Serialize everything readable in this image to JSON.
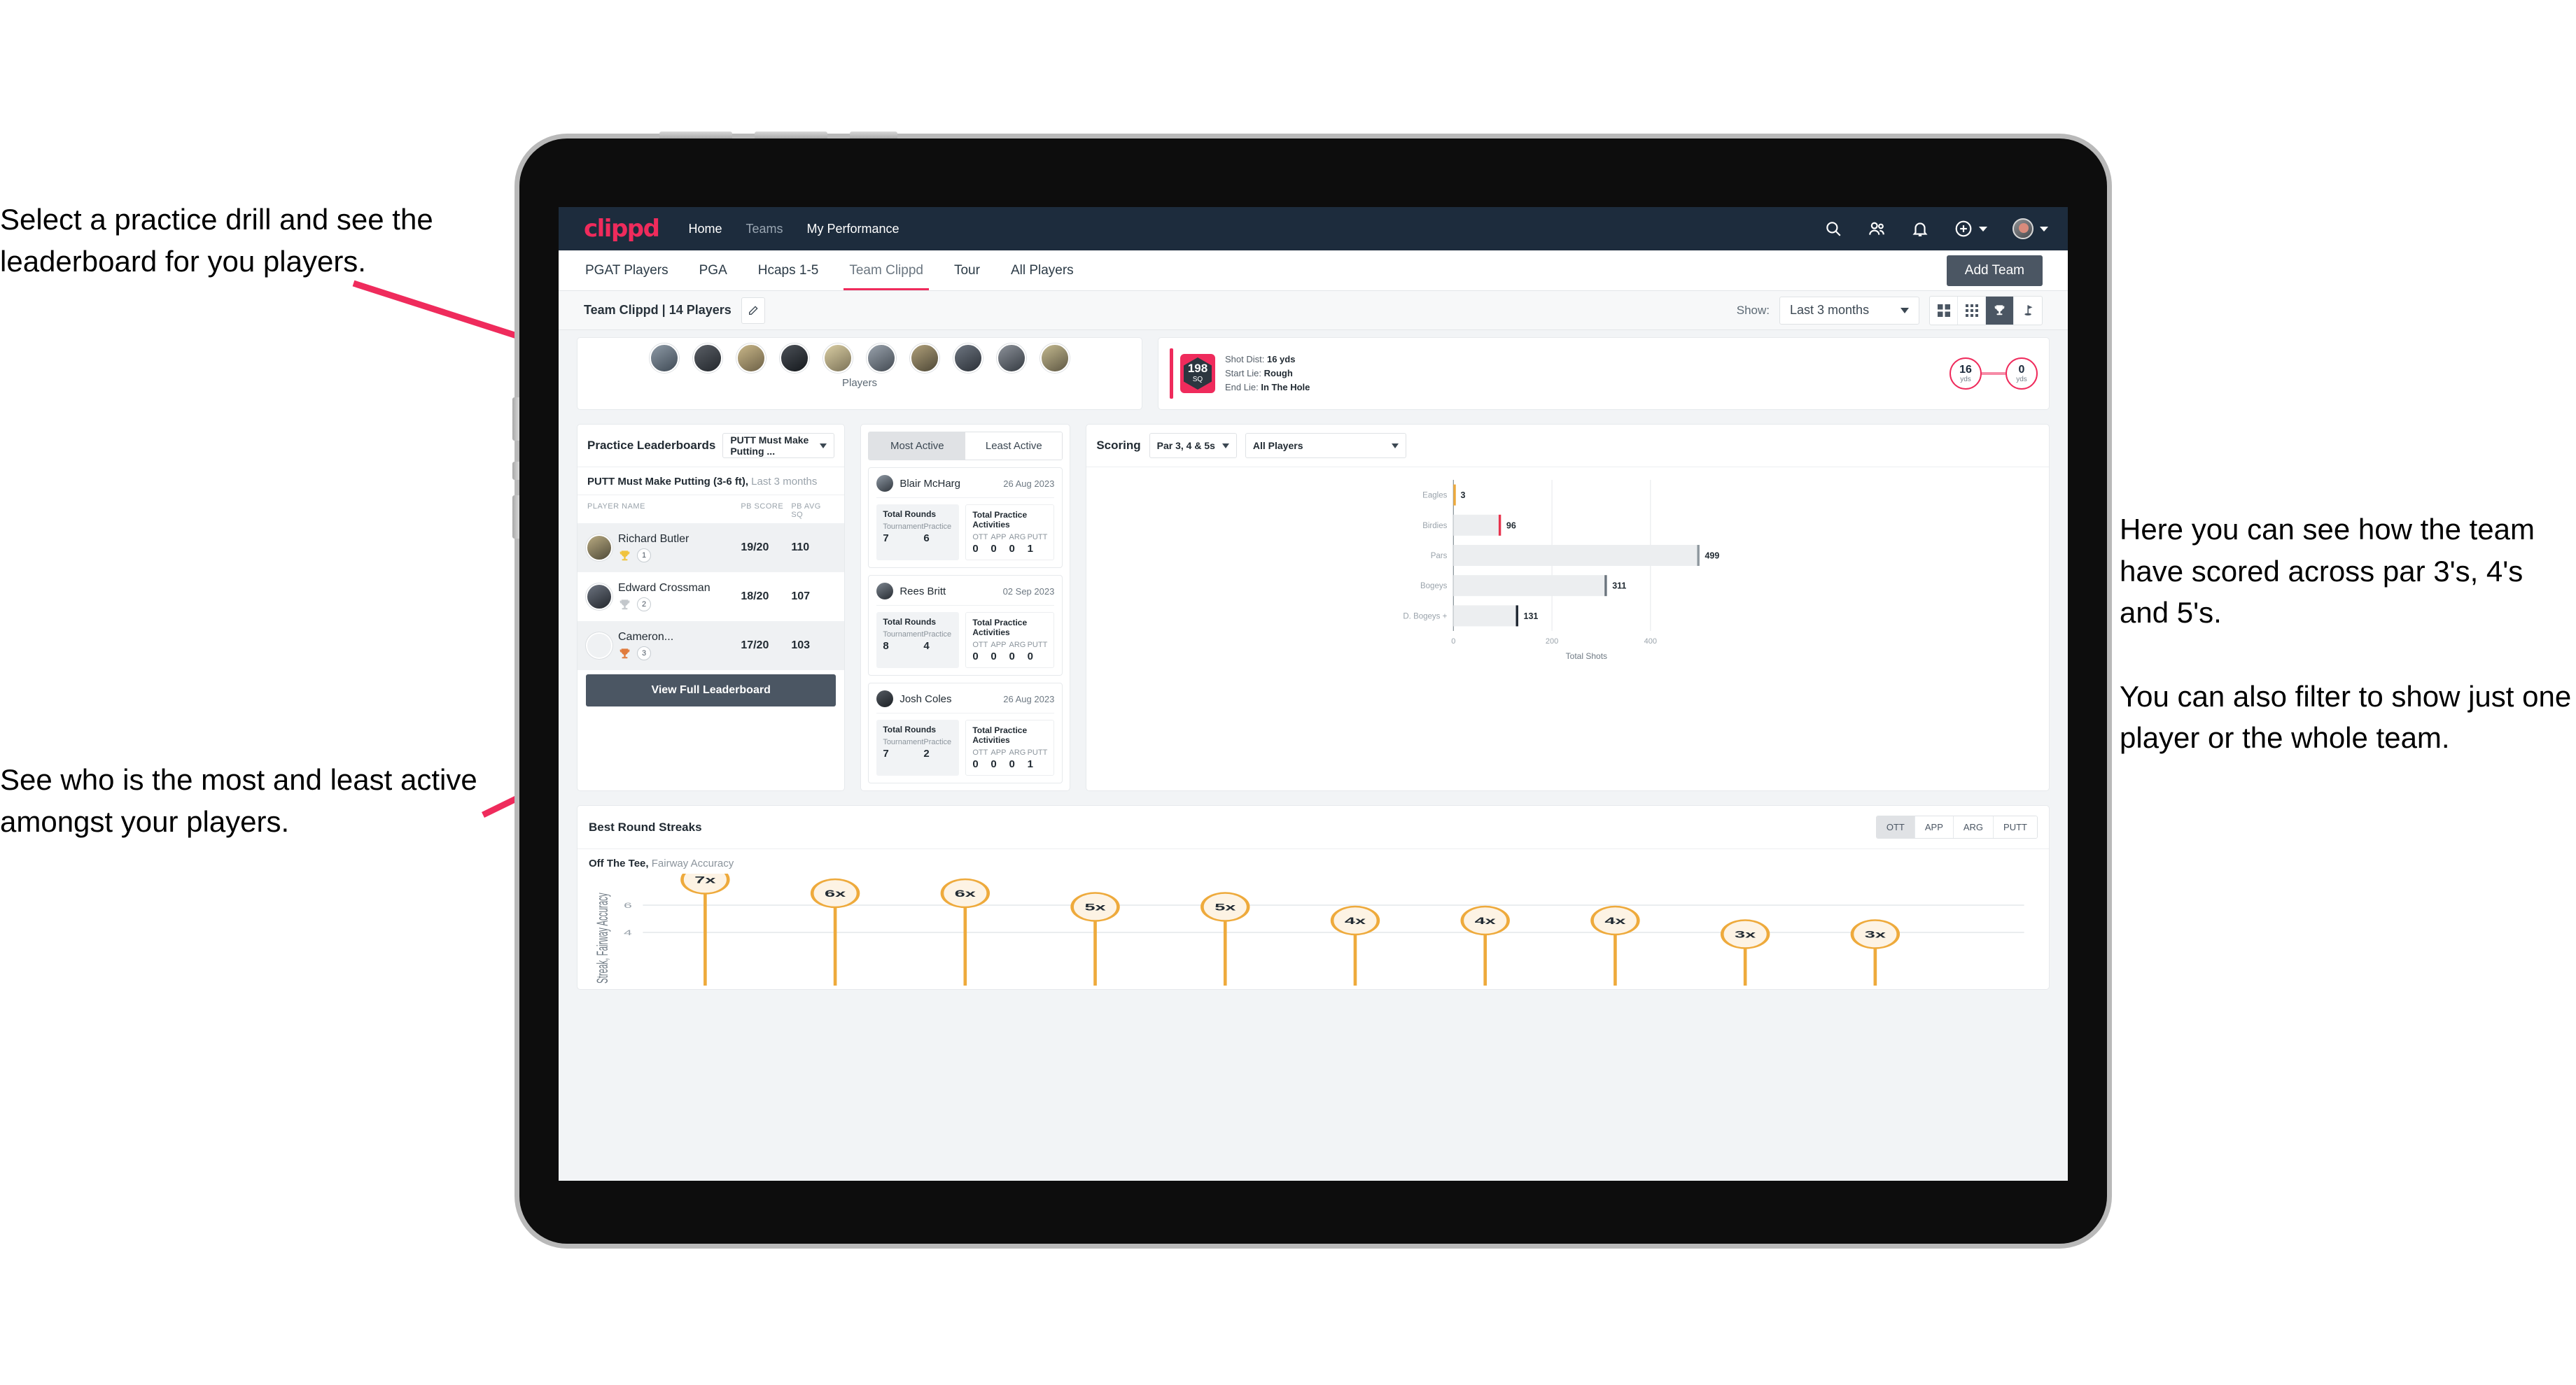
{
  "annotations": {
    "practice": "Select a practice drill and see the leaderboard for you players.",
    "active": "See who is the most and least active amongst your players.",
    "scoring": "Here you can see how the team have scored across par 3's, 4's and 5's.\n\nYou can also filter to show just one player or the whole team."
  },
  "appbar": {
    "logo": "clippd",
    "nav": [
      {
        "label": "Home",
        "dim": false
      },
      {
        "label": "Teams",
        "dim": true
      },
      {
        "label": "My Performance",
        "dim": false
      }
    ],
    "icons": [
      "search-icon",
      "people-icon",
      "bell-icon",
      "plus-circle-icon",
      "avatar"
    ]
  },
  "tabs": [
    {
      "label": "PGAT Players",
      "active": false
    },
    {
      "label": "PGA",
      "active": false
    },
    {
      "label": "Hcaps 1-5",
      "active": false
    },
    {
      "label": "Team Clippd",
      "active": true
    },
    {
      "label": "Tour",
      "active": false
    },
    {
      "label": "All Players",
      "active": false
    }
  ],
  "add_team_label": "Add Team",
  "toolbar": {
    "team_label": "Team Clippd | 14 Players",
    "edit_icon": "pencil-icon",
    "show_label": "Show:",
    "range_value": "Last 3 months",
    "view_modes": [
      {
        "name": "grid-2x2-icon",
        "active": false
      },
      {
        "name": "grid-3x3-icon",
        "active": false
      },
      {
        "name": "trophy-icon",
        "active": true
      },
      {
        "name": "flag-icon",
        "active": false
      }
    ]
  },
  "players_card": {
    "caption": "Players",
    "count": 10
  },
  "shot_card": {
    "sq_value": "198",
    "sq_unit": "SQ",
    "lines": [
      {
        "key": "Shot Dist:",
        "val": "16 yds"
      },
      {
        "key": "Start Lie:",
        "val": "Rough"
      },
      {
        "key": "End Lie:",
        "val": "In The Hole"
      }
    ],
    "start_dist": "16",
    "start_unit": "yds",
    "end_dist": "0",
    "end_unit": "yds"
  },
  "leaderboard": {
    "title": "Practice Leaderboards",
    "drill_select": "PUTT Must Make Putting ...",
    "subtitle_bold": "PUTT Must Make Putting (3-6 ft),",
    "subtitle_rest": " Last 3 months",
    "columns": [
      "PLAYER NAME",
      "PB SCORE",
      "PB AVG SQ"
    ],
    "rows": [
      {
        "name": "Richard Butler",
        "rank": "1",
        "trophy": "gold",
        "score": "19/20",
        "avg_sq": "110"
      },
      {
        "name": "Edward Crossman",
        "rank": "2",
        "trophy": "silver",
        "score": "18/20",
        "avg_sq": "107"
      },
      {
        "name": "Cameron...",
        "rank": "3",
        "trophy": "bronze",
        "score": "17/20",
        "avg_sq": "103"
      }
    ],
    "button": "View Full Leaderboard"
  },
  "activity": {
    "tabs": [
      {
        "label": "Most Active",
        "active": true
      },
      {
        "label": "Least Active",
        "active": false
      }
    ],
    "rounds_title": "Total Rounds",
    "practice_title": "Total Practice Activities",
    "rounds_keys": [
      "Tournament",
      "Practice"
    ],
    "practice_keys": [
      "OTT",
      "APP",
      "ARG",
      "PUTT"
    ],
    "items": [
      {
        "name": "Blair McHarg",
        "date": "26 Aug 2023",
        "rounds": [
          "7",
          "6"
        ],
        "practice": [
          "0",
          "0",
          "0",
          "1"
        ]
      },
      {
        "name": "Rees Britt",
        "date": "02 Sep 2023",
        "rounds": [
          "8",
          "4"
        ],
        "practice": [
          "0",
          "0",
          "0",
          "0"
        ]
      },
      {
        "name": "Josh Coles",
        "date": "26 Aug 2023",
        "rounds": [
          "7",
          "2"
        ],
        "practice": [
          "0",
          "0",
          "0",
          "1"
        ]
      }
    ]
  },
  "scoring": {
    "title": "Scoring",
    "par_filter": "Par 3, 4 & 5s",
    "player_filter": "All Players"
  },
  "streaks": {
    "title": "Best Round Streaks",
    "segments": [
      {
        "label": "OTT",
        "active": true
      },
      {
        "label": "APP",
        "active": false
      },
      {
        "label": "ARG",
        "active": false
      },
      {
        "label": "PUTT",
        "active": false
      }
    ],
    "sub_bold": "Off The Tee,",
    "sub_rest": " Fairway Accuracy"
  },
  "colors": {
    "brand_pink": "#ef2b5c",
    "navy": "#1d2c3d",
    "slate": "#4b5663",
    "amber": "#eeaa3c",
    "bar_grey": "#e9ebed"
  },
  "chart_data": [
    {
      "type": "bar",
      "orientation": "horizontal",
      "title": "Scoring",
      "categories": [
        "Eagles",
        "Birdies",
        "Pars",
        "Bogeys",
        "D. Bogeys +"
      ],
      "values": [
        3,
        96,
        499,
        311,
        131
      ],
      "bar_colors": [
        "#eeaa3c",
        "#e8344e",
        "#8e979e",
        "#6b757d",
        "#1d2530"
      ],
      "xlabel": "Total Shots",
      "ylabel": "",
      "xlim": [
        0,
        540
      ],
      "xticks": [
        0,
        200,
        400
      ],
      "grid": true,
      "legend": "none"
    },
    {
      "type": "scatter",
      "title": "Best Round Streaks",
      "subtitle": "Off The Tee, Fairway Accuracy",
      "ylabel": "Streak, Fairway Accuracy",
      "xlabel": "",
      "labels": [
        "7x",
        "6x",
        "6x",
        "5x",
        "5x",
        "4x",
        "4x",
        "4x",
        "3x",
        "3x"
      ],
      "values": [
        7,
        6,
        6,
        5,
        5,
        4,
        4,
        4,
        3,
        3
      ],
      "yticks": [
        4,
        6
      ],
      "ylim": [
        0,
        8
      ],
      "grid": true,
      "marker_color": "#eeaa3c",
      "marker_fill": "#fdf3e4"
    }
  ]
}
